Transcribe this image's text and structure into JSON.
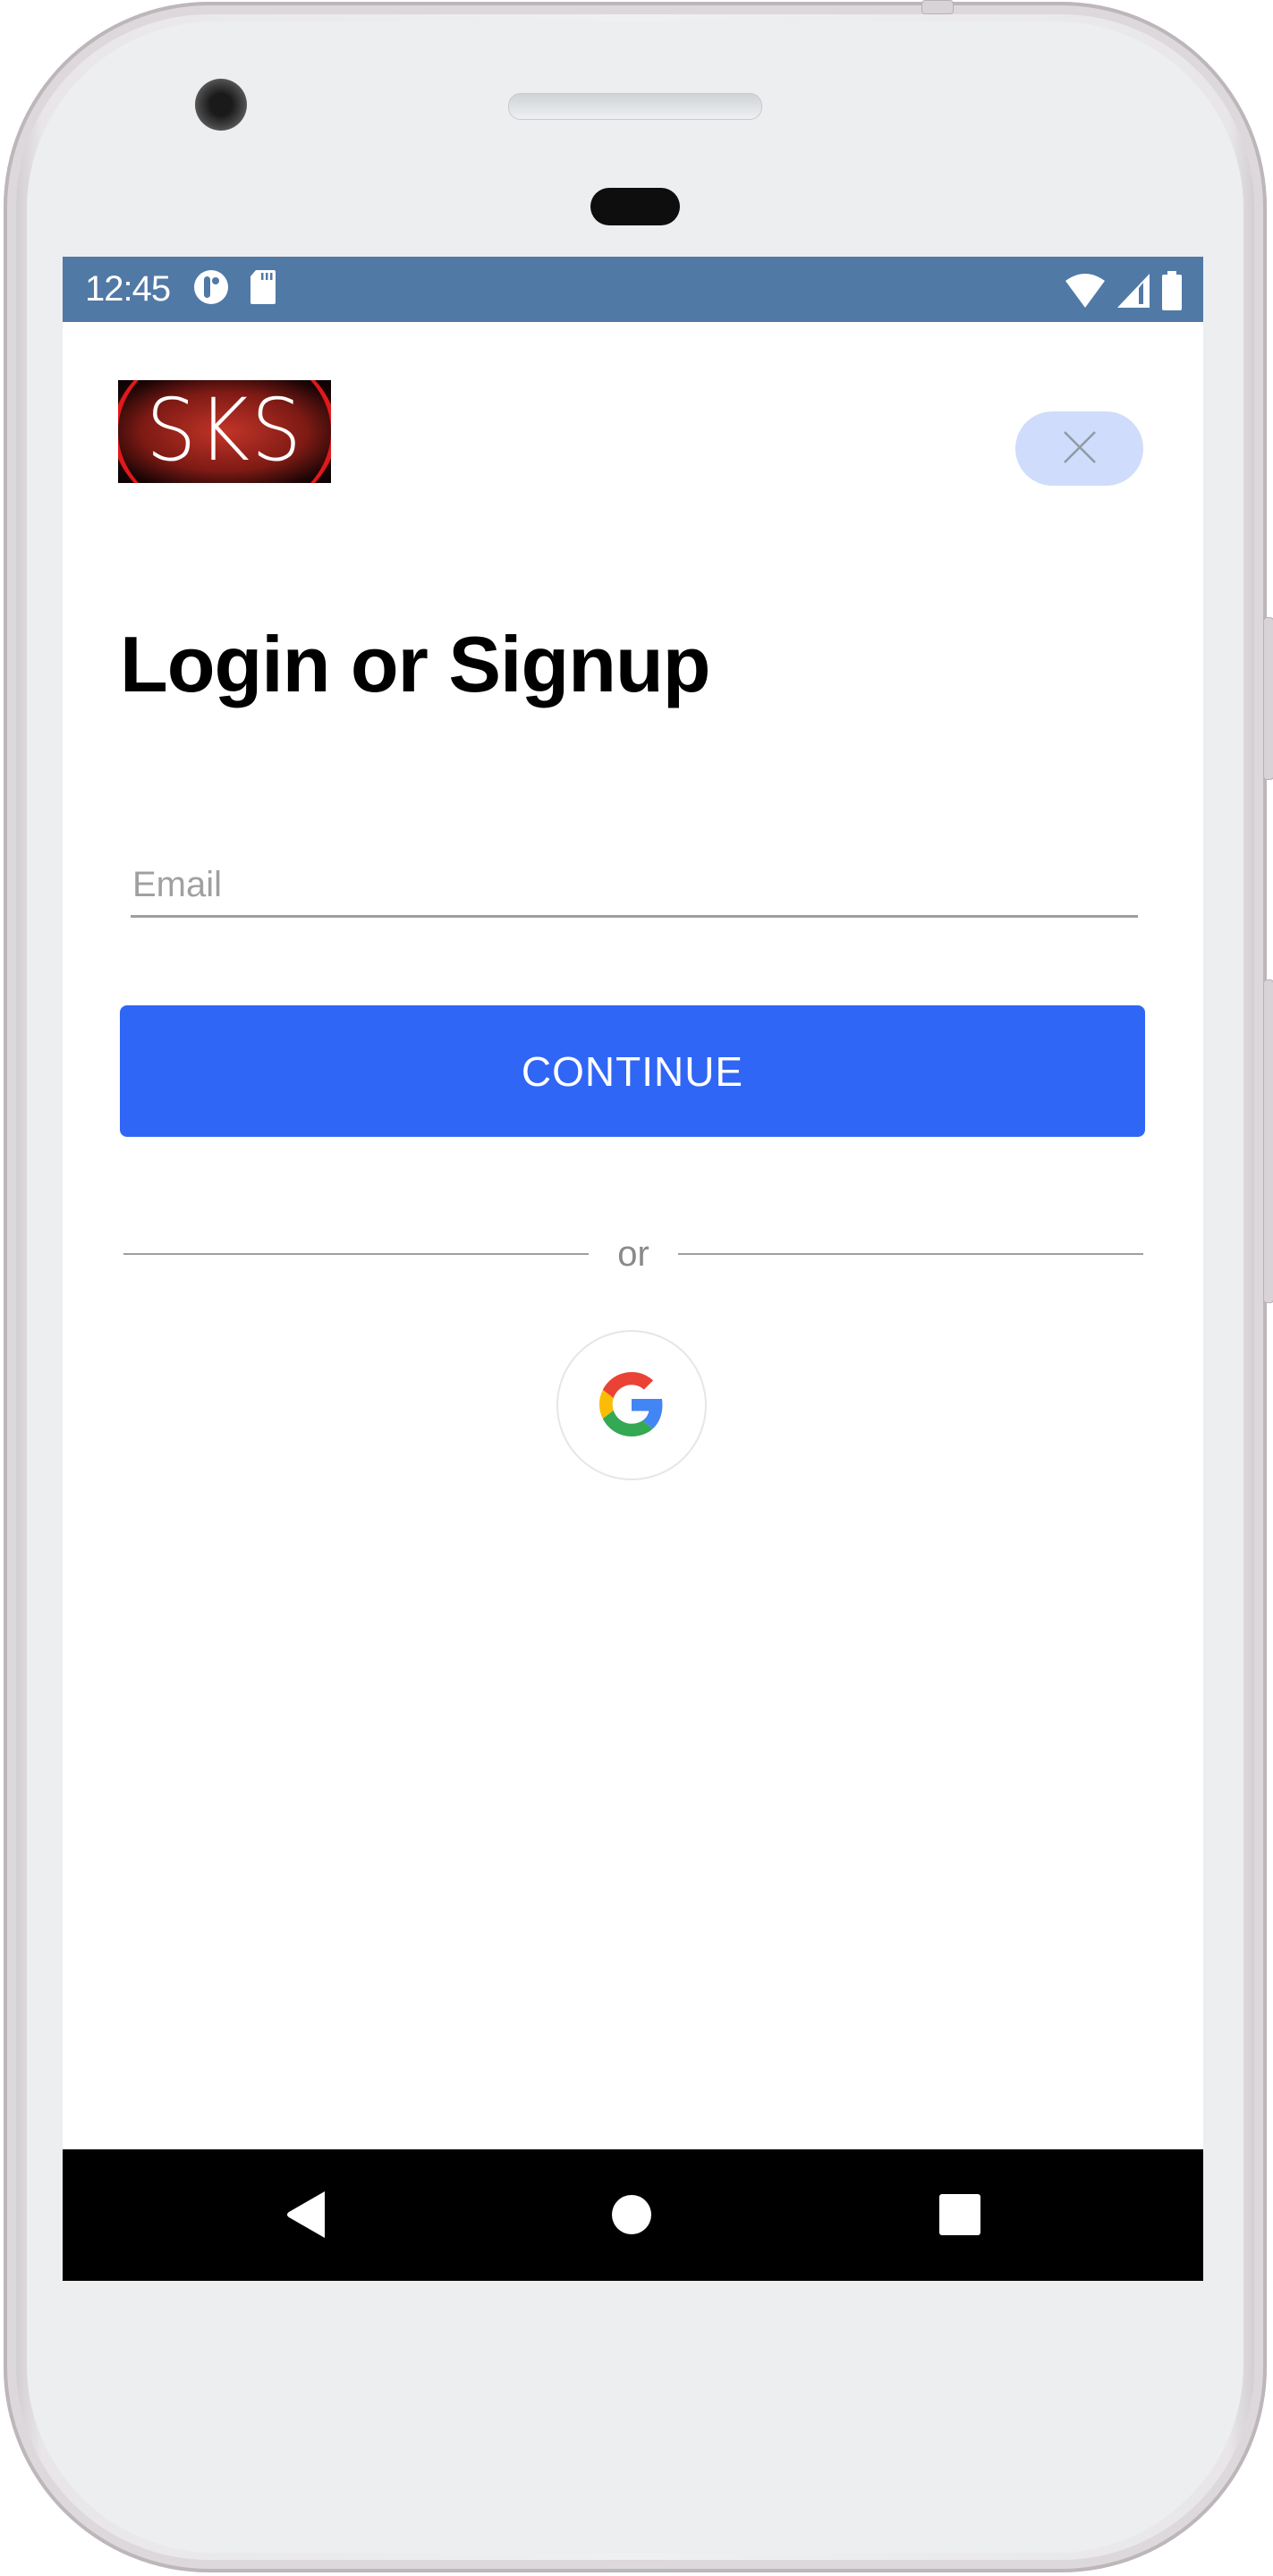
{
  "status_bar": {
    "time": "12:45",
    "left_icons": [
      "data-saver-icon",
      "sd-card-icon"
    ],
    "right_icons": [
      "wifi-icon",
      "cellular-signal-icon",
      "battery-icon"
    ],
    "background": "#5079a6"
  },
  "header": {
    "logo_text": "SKS",
    "close_icon": "close-icon"
  },
  "main": {
    "title": "Login or Signup",
    "email": {
      "placeholder": "Email",
      "value": ""
    },
    "continue_label": "CONTINUE",
    "divider_text": "or",
    "google_icon": "google-g-icon"
  },
  "colors": {
    "accent": "#3066f5",
    "close_bg": "#d0dcfb",
    "google_red": "#ea4335",
    "google_yellow": "#fbbc05",
    "google_green": "#34a853",
    "google_blue": "#4285f4"
  },
  "nav_bar": {
    "icons": [
      "back-icon",
      "home-icon",
      "recents-icon"
    ]
  }
}
